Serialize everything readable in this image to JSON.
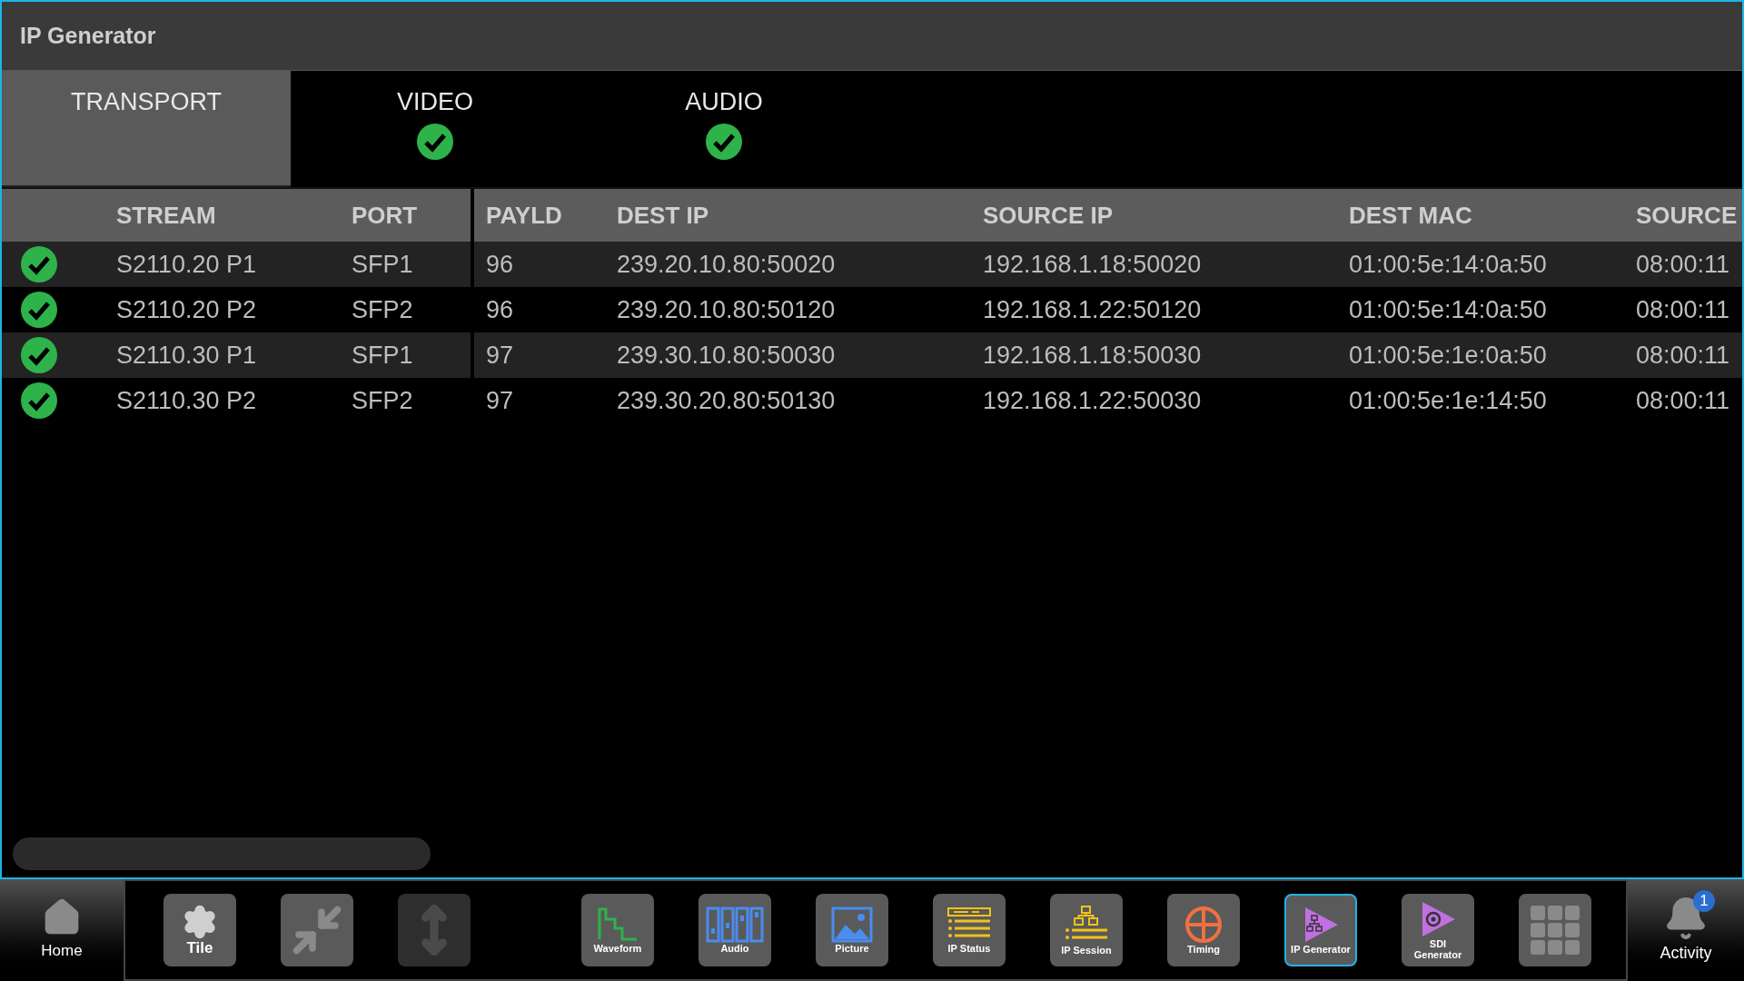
{
  "window": {
    "title": "IP Generator"
  },
  "tabs": [
    {
      "label": "TRANSPORT",
      "selected": true,
      "ok": false
    },
    {
      "label": "VIDEO",
      "selected": false,
      "ok": true
    },
    {
      "label": "AUDIO",
      "selected": false,
      "ok": true
    }
  ],
  "table": {
    "columns": [
      "STREAM",
      "PORT",
      "PAYLD",
      "DEST IP",
      "SOURCE IP",
      "DEST MAC",
      "SOURCE"
    ],
    "rows": [
      {
        "ok": true,
        "cells": [
          "S2110.20 P1",
          "SFP1",
          "96",
          "239.20.10.80:50020",
          "192.168.1.18:50020",
          "01:00:5e:14:0a:50",
          "08:00:11"
        ]
      },
      {
        "ok": true,
        "cells": [
          "S2110.20 P2",
          "SFP2",
          "96",
          "239.20.10.80:50120",
          "192.168.1.22:50120",
          "01:00:5e:14:0a:50",
          "08:00:11"
        ]
      },
      {
        "ok": true,
        "cells": [
          "S2110.30 P1",
          "SFP1",
          "97",
          "239.30.10.80:50030",
          "192.168.1.18:50030",
          "01:00:5e:1e:0a:50",
          "08:00:11"
        ]
      },
      {
        "ok": true,
        "cells": [
          "S2110.30 P2",
          "SFP2",
          "97",
          "239.30.20.80:50130",
          "192.168.1.22:50030",
          "01:00:5e:1e:14:50",
          "08:00:11"
        ]
      }
    ]
  },
  "toolbar": {
    "home": "Home",
    "buttons": [
      {
        "kind": "tile",
        "label": "Tile",
        "selected": false,
        "disabled": false
      },
      {
        "kind": "collapse",
        "selected": false,
        "disabled": false
      },
      {
        "kind": "move",
        "selected": false,
        "disabled": true
      },
      {
        "kind": "waveform",
        "label": "Waveform",
        "selected": false,
        "disabled": false
      },
      {
        "kind": "audio",
        "label": "Audio",
        "selected": false,
        "disabled": false
      },
      {
        "kind": "picture",
        "label": "Picture",
        "selected": false,
        "disabled": false
      },
      {
        "kind": "ip-status",
        "label": "IP Status",
        "selected": false,
        "disabled": false
      },
      {
        "kind": "ip-session",
        "label": "IP Session",
        "selected": false,
        "disabled": false
      },
      {
        "kind": "timing",
        "label": "Timing",
        "selected": false,
        "disabled": false
      },
      {
        "kind": "ip-generator",
        "label": "IP Generator",
        "selected": true,
        "disabled": false
      },
      {
        "kind": "sdi-generator",
        "label": "SDI Generator",
        "selected": false,
        "disabled": false
      },
      {
        "kind": "apps",
        "selected": false,
        "disabled": false
      }
    ],
    "activity": {
      "label": "Activity",
      "badge": "1"
    }
  }
}
